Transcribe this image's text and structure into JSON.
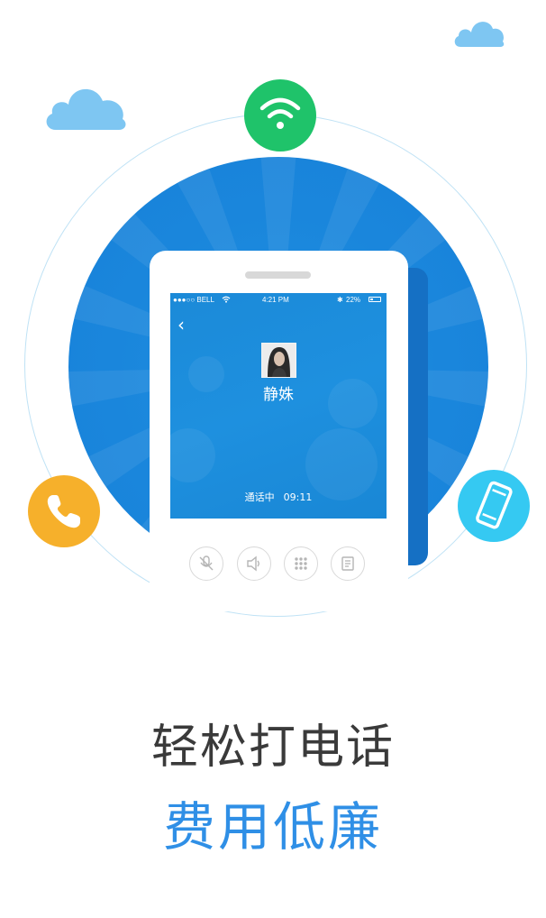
{
  "phone": {
    "status": {
      "carrier": "●●●○○ BELL",
      "time": "4:21 PM",
      "battery": "22%"
    },
    "contact_name": "静姝",
    "call_status_label": "通话中",
    "call_duration": "09:11"
  },
  "icons": {
    "wifi": "wifi-icon",
    "phone_call": "phone-call-icon",
    "mobile": "mobile-phone-icon",
    "back": "back-chevron-icon",
    "mute": "mute-icon",
    "speaker": "speaker-icon",
    "keypad": "keypad-icon",
    "contacts": "contacts-icon"
  },
  "colors": {
    "primary_blue": "#1a86dc",
    "wifi_green": "#1fc36a",
    "call_orange": "#f6b02b",
    "mobile_cyan": "#35c9f2",
    "accent_text": "#2f8fe6"
  },
  "headline": "轻松打电话",
  "subheadline": "费用低廉"
}
